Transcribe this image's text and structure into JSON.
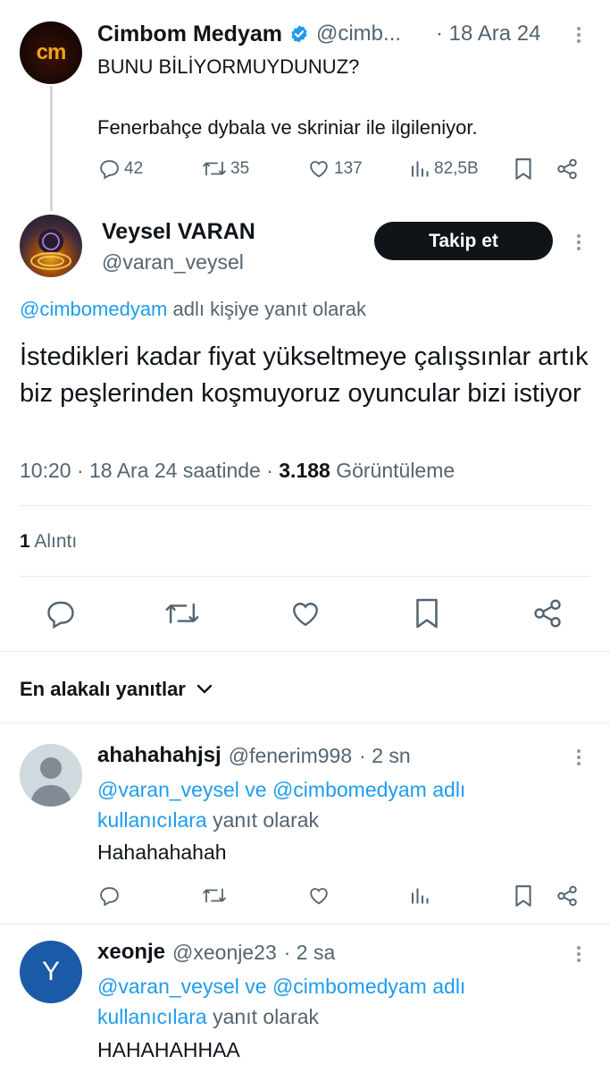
{
  "parent": {
    "name": "Cimbom Medyam",
    "handle": "@cimb...",
    "date": "· 18 Ara 24",
    "avatar_text": "cm",
    "line1": "BUNU BİLİYORMUYDUNUZ?",
    "line2": "Fenerbahçe dybala ve skriniar ile ilgileniyor.",
    "stats": {
      "replies": "42",
      "retweets": "35",
      "likes": "137",
      "views": "82,5B"
    }
  },
  "main": {
    "name": "Veysel VARAN",
    "handle": "@varan_veysel",
    "follow_label": "Takip et",
    "reply_to_handle": "@cimbomedyam",
    "reply_to_suffix": "adlı kişiye yanıt olarak",
    "text": "İstedikleri kadar fiyat yükseltmeye çalışsınlar artık biz peşlerinden koşmuyoruz oyuncular bizi istiyor",
    "time": "10:20 · 18 Ara 24 saatinde ·",
    "views_count": "3.188",
    "views_label": "Görüntüleme",
    "quotes_count": "1",
    "quotes_label": "Alıntı"
  },
  "replies_header": {
    "label": "En alakalı yanıtlar"
  },
  "replies": [
    {
      "name": "ahahahahjsj",
      "handle": "@fenerim998",
      "time": "· 2 sn",
      "mention1": "@varan_veysel",
      "mention_join": "ve",
      "mention2": "@cimbomedyam adlı",
      "mention_users": "kullanıcılara",
      "mention_suffix": "yanıt olarak",
      "text": "Hahahahahah"
    },
    {
      "name": "xeonje",
      "handle": "@xeonje23",
      "time": "· 2 sa",
      "avatar_letter": "Y",
      "mention1": "@varan_veysel",
      "mention_join": "ve",
      "mention2": "@cimbomedyam adlı",
      "mention_users": "kullanıcılara",
      "mention_suffix": "yanıt olarak",
      "text": "HAHAHAHHAA"
    }
  ],
  "colors": {
    "link": "#1d9bf0",
    "muted": "#536471",
    "verified": "#1d9bf0",
    "follow_button": "#0f1419",
    "avatar_y": "#1b5aa6"
  }
}
